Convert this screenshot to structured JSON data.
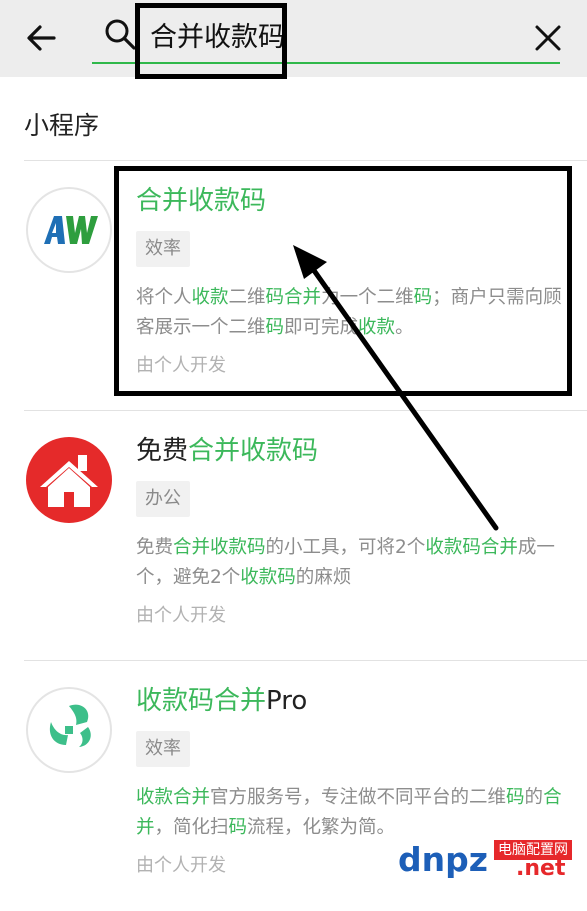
{
  "search": {
    "query": "合并收款码"
  },
  "section": {
    "title": "小程序"
  },
  "results": [
    {
      "title_parts": [
        {
          "text": "合并收款码",
          "hl": true
        }
      ],
      "tag": "效率",
      "desc_parts": [
        {
          "text": "将个人",
          "hl": false
        },
        {
          "text": "收款",
          "hl": true
        },
        {
          "text": "二维",
          "hl": false
        },
        {
          "text": "码合并",
          "hl": true
        },
        {
          "text": "为一个二维",
          "hl": false
        },
        {
          "text": "码",
          "hl": true
        },
        {
          "text": "；商户只需向顾客展示一个二维",
          "hl": false
        },
        {
          "text": "码",
          "hl": true
        },
        {
          "text": "即可完成",
          "hl": false
        },
        {
          "text": "收款",
          "hl": true
        },
        {
          "text": "。",
          "hl": false
        }
      ],
      "developer": "由个人开发",
      "avatar_text": "AW"
    },
    {
      "title_parts": [
        {
          "text": "免费",
          "hl": false
        },
        {
          "text": "合并收款码",
          "hl": true
        }
      ],
      "tag": "办公",
      "desc_parts": [
        {
          "text": "免费",
          "hl": false
        },
        {
          "text": "合并收款码",
          "hl": true
        },
        {
          "text": "的小工具，可将2个",
          "hl": false
        },
        {
          "text": "收款码合并",
          "hl": true
        },
        {
          "text": "成一个，避免2个",
          "hl": false
        },
        {
          "text": "收款码",
          "hl": true
        },
        {
          "text": "的麻烦",
          "hl": false
        }
      ],
      "developer": "由个人开发"
    },
    {
      "title_parts": [
        {
          "text": "收款码合并",
          "hl": true
        },
        {
          "text": "Pro",
          "hl": false
        }
      ],
      "tag": "效率",
      "desc_parts": [
        {
          "text": "收款合并",
          "hl": true
        },
        {
          "text": "官方服务号，专注做不同平台的二维",
          "hl": false
        },
        {
          "text": "码",
          "hl": true
        },
        {
          "text": "的",
          "hl": false
        },
        {
          "text": "合并",
          "hl": true
        },
        {
          "text": "，简化扫",
          "hl": false
        },
        {
          "text": "码",
          "hl": true
        },
        {
          "text": "流程，化繁为简。",
          "hl": false
        }
      ],
      "developer": "由个人开发"
    }
  ],
  "watermark": {
    "logo": "dnpz",
    "tag": "电脑配置网",
    "suffix": ".net"
  },
  "colors": {
    "highlight": "#3cb85b",
    "header_bg": "#ededed",
    "underline": "#2fb84a"
  },
  "icons": [
    "back-arrow-icon",
    "search-icon",
    "close-icon"
  ]
}
